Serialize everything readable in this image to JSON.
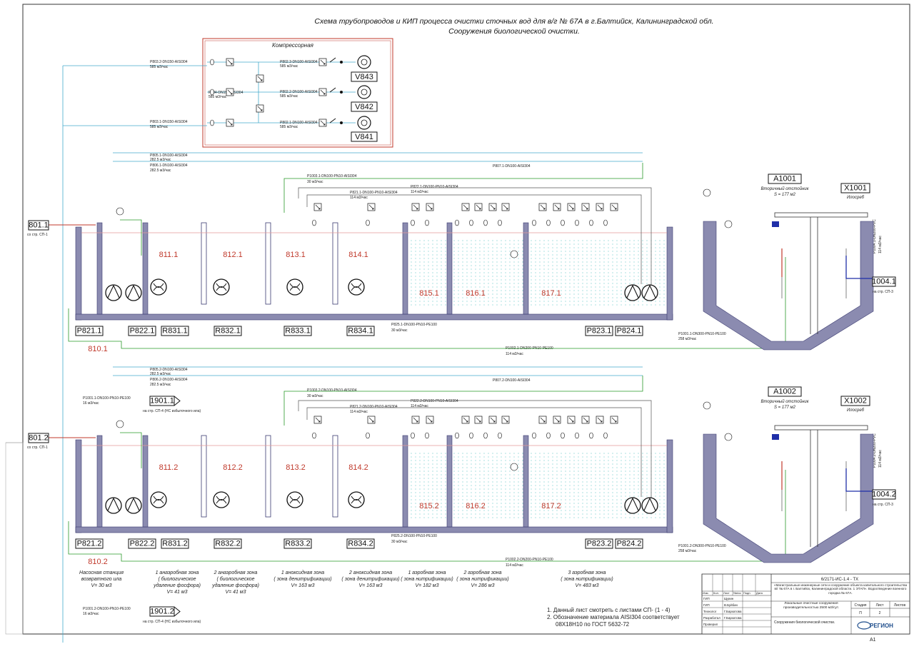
{
  "title": {
    "line1": "Схема трубопроводов и КИП процесса очистки сточных вод для в/г № 67А в г.Балтийск, Калининградской обл.",
    "line2": "Сооружения биологической очистки."
  },
  "compressor": {
    "title": "Компрессорная",
    "blowers": [
      "V843",
      "V842",
      "V841"
    ],
    "pipes": [
      {
        "name": "P802.3-DN100-AISI304",
        "flow": "585 м3/час"
      },
      {
        "name": "P802.2-DN100-AISI304",
        "flow": "585 м3/час"
      },
      {
        "name": "P802.1-DN100-AISI304",
        "flow": "585 м3/час"
      }
    ],
    "header": {
      "name": "P804-DN150-AISI304",
      "flow": "585 м3/час"
    }
  },
  "air_lines": [
    {
      "name": "P803.2-DN150-AISI304",
      "flow": "585 м3/час"
    },
    {
      "name": "P803.1-DN150-AISI304",
      "flow": "585 м3/час"
    }
  ],
  "lines": [
    {
      "inlet": "801.1",
      "inlet_note": "со стр. СП-1",
      "pipes": {
        "p805": "P805.1-DN100-AISI304",
        "p805_flow": "282.5 м3/час",
        "p806": "P806.1-DN100-AISI304",
        "p806_flow": "282.5 м3/час",
        "p807": "P807.1-DN100-AISI304",
        "p1003": "P1003.1-DN100-PN10-AISI304",
        "p1003_flow": "30 м3/час",
        "p822": "P822.1-DN100-PN10-AISI304",
        "p822_flow": "114 м3/час",
        "p821": "P821.1-DN100-PN10-AISI304",
        "p821_flow": "114 м3/час",
        "p825": "P825.1-DN100-PN10-PE100",
        "p825_flow": "30 м3/час",
        "p1002": "P1002.1-DN200-PN10-PE100",
        "p1002_flow": "114 м3/час",
        "p1001": "P1001.1-DN300-PN10-PE100",
        "p1001_flow": "258 м3/час",
        "p1004": "P1004.1-DN200-PVC",
        "p1004_flow": "114 м3/час"
      },
      "zones": [
        "811.1",
        "812.1",
        "813.1",
        "814.1",
        "815.1",
        "816.1",
        "817.1"
      ],
      "sump": "810.1",
      "equipment": [
        "P821.1",
        "P822.1",
        "R831.1",
        "R832.1",
        "R833.1",
        "R834.1",
        "P823.1",
        "P824.1"
      ],
      "clarifier": {
        "tag": "A1001",
        "name": "Вторичный отстойник",
        "area": "S = 177 м2"
      },
      "scraper": {
        "tag": "X1001",
        "name": "Илосреб"
      },
      "outlet": "1004.1",
      "outlet_note": "на стр. СП-3",
      "overflow": "1901.1",
      "overflow_pipe": "P1001.1-DN100-PN10-PE100",
      "overflow_flow": "16 м3/час",
      "overflow_note": "на стр. СП-4 (НС избыточного ила)"
    },
    {
      "inlet": "801.2",
      "inlet_note": "со стр. СП-1",
      "pipes": {
        "p805": "P805.2-DN100-AISI304",
        "p805_flow": "282.5 м3/час",
        "p806": "P806.2-DN100-AISI304",
        "p806_flow": "282.5 м3/час",
        "p807": "P807.2-DN100-AISI304",
        "p1003": "P1003.2-DN100-PN10-AISI304",
        "p1003_flow": "30 м3/час",
        "p822": "P822.2-DN100-PN10-AISI304",
        "p822_flow": "114 м3/час",
        "p821": "P821.2-DN100-PN10-AISI304",
        "p821_flow": "114 м3/час",
        "p825": "P825.2-DN100-PN10-PE100",
        "p825_flow": "30 м3/час",
        "p1002": "P1002.2-DN200-PN10-PE100",
        "p1002_flow": "114 м3/час",
        "p1001": "P1001.2-DN300-PN10-PE100",
        "p1001_flow": "258 м3/час",
        "p1004": "P1004.2-DN200-PVC",
        "p1004_flow": "114 м3/час"
      },
      "zones": [
        "811.2",
        "812.2",
        "813.2",
        "814.2",
        "815.2",
        "816.2",
        "817.2"
      ],
      "sump": "810.2",
      "equipment": [
        "P821.2",
        "P822.2",
        "R831.2",
        "R832.2",
        "R833.2",
        "R834.2",
        "P823.2",
        "P824.2"
      ],
      "clarifier": {
        "tag": "A1002",
        "name": "Вторичный отстойник",
        "area": "S = 177 м2"
      },
      "scraper": {
        "tag": "X1002",
        "name": "Илосреб"
      },
      "outlet": "1004.2",
      "outlet_note": "на стр. СП-3",
      "overflow": "1901.2",
      "overflow_pipe": "P1001.2-DN100-PN10-PE100",
      "overflow_flow": "16 м3/час",
      "overflow_note": "на стр. СП-4 (НС избыточного ила)"
    }
  ],
  "captions": [
    [
      "Насосная станция",
      "возвратного ила",
      "V= 30 м3"
    ],
    [
      "1 анаэробная зона",
      "( биологическое",
      "удаление фосфора)",
      "V= 41 м3"
    ],
    [
      "2 анаэробная зона",
      "( биологическое",
      "удаление фосфора)",
      "V= 41 м3"
    ],
    [
      "1 аноксидная зона",
      "( зона денитрификации)",
      "V= 163 м3"
    ],
    [
      "2 аноксидная зона",
      "( зона денитрификации)",
      "V= 163 м3"
    ],
    [
      "1 аэробная зона",
      "( зона нитрификации)",
      "V= 182 м3"
    ],
    [
      "2 аэробная зона",
      "( зона нитрификации)",
      "V= 286 м3"
    ],
    [
      "3 аэробная зона",
      "( зона нитрификации)",
      "V= 483 м3"
    ]
  ],
  "notes": [
    "1. Данный лист смотреть с листами СП- (1 - 4)",
    "2. Обозначение материала AISI304 соответствует",
    "08Х18Н10 по ГОСТ 5632-72"
  ],
  "stamp": {
    "code": "6/2171-ИС-1.4 - ТХ",
    "project": "«Магистральные инженерные сети и сооружение объекта капитального строительства в/г № 67А в г. Балтийск, Калининградской области. 1 ЭТАП». Водоотведение военного городка № 67А.",
    "object": "Локальные очистные сооружения производительностью 2500 м3/сут.",
    "sheet_title": "Сооружения биологической очистки.",
    "headers": [
      "Изм.",
      "Кол.",
      "Лист",
      "№doc",
      "Подп.",
      "Дата"
    ],
    "stage_headers": [
      "Стадия",
      "Лист",
      "Листов"
    ],
    "stage": "П",
    "sheet_no": "2",
    "roles": [
      "ГИП",
      "ГИП",
      "Технолог",
      "Разработал",
      "Проверил"
    ],
    "names": [
      "Щукин",
      "В.Буйбин",
      "Г.Бархатова",
      "Г.Бархатова",
      ""
    ],
    "company": "РЕГИОН",
    "format": "А1"
  }
}
